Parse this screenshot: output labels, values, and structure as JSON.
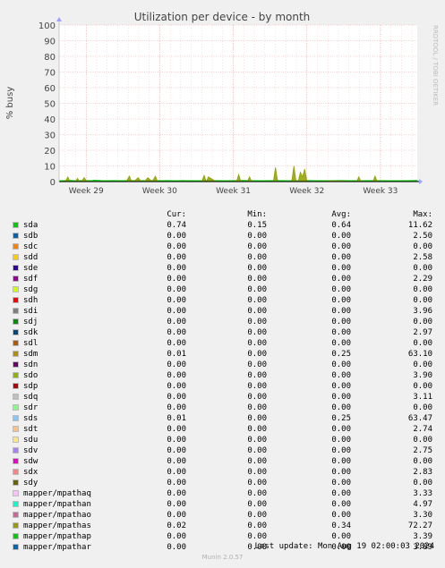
{
  "chart_data": {
    "type": "area",
    "title": "Utilization per device - by month",
    "ylabel": "% busy",
    "side_label": "RRDTOOL / TOBI OETIKER",
    "ylim": [
      0,
      100
    ],
    "yticks": [
      0,
      10,
      20,
      30,
      40,
      50,
      60,
      70,
      80,
      90,
      100
    ],
    "xlim": [
      0,
      33.1
    ],
    "xticks": [
      {
        "label": "Week 29",
        "x": 2.5
      },
      {
        "label": "Week 30",
        "x": 9.3
      },
      {
        "label": "Week 31",
        "x": 16.1
      },
      {
        "label": "Week 32",
        "x": 22.9
      },
      {
        "label": "Week 33",
        "x": 29.7
      }
    ],
    "grid": true,
    "series": [
      {
        "name": "sda",
        "color": "#00cc00",
        "x": [
          0,
          0.5,
          0.8,
          1.4,
          2.0,
          3.0,
          3.3,
          4.0,
          4.5,
          5.0,
          5.5,
          6.0,
          6.5,
          7.0,
          7.5,
          8.0,
          8.5,
          9.0,
          9.5,
          10.0,
          10.5,
          11.0,
          11.5,
          12.0,
          13.0,
          14.0,
          15.0,
          16.0,
          17.0,
          18.0,
          19.0,
          20.0,
          21.0,
          22.0,
          23.0,
          24.0,
          25.0,
          26.0,
          27.0,
          28.0,
          29.0,
          30.0,
          31.0,
          32.0,
          33.1
        ],
        "y": [
          0.6,
          0.6,
          1.0,
          0.6,
          0.7,
          0.6,
          0.9,
          0.6,
          0.6,
          0.7,
          0.6,
          0.6,
          0.8,
          0.6,
          0.6,
          0.6,
          0.7,
          0.6,
          0.6,
          0.7,
          0.6,
          0.6,
          0.7,
          0.6,
          0.6,
          0.7,
          0.6,
          0.6,
          0.8,
          0.6,
          0.6,
          0.7,
          0.6,
          0.6,
          0.7,
          0.6,
          0.6,
          0.7,
          0.6,
          0.6,
          0.7,
          0.6,
          0.6,
          0.6,
          0.74
        ]
      },
      {
        "name": "mapper/mpathas",
        "color": "#8fa000",
        "x": [
          0,
          0.6,
          0.8,
          1.0,
          1.5,
          1.7,
          1.9,
          2.1,
          2.3,
          2.6,
          4.5,
          6.2,
          6.5,
          6.7,
          6.9,
          7.3,
          7.6,
          7.9,
          8.2,
          8.6,
          8.9,
          9.1,
          9.3,
          13.2,
          13.4,
          13.6,
          13.8,
          14.5,
          16.4,
          16.6,
          16.8,
          17.0,
          17.4,
          17.6,
          17.8,
          19.8,
          20.0,
          20.2,
          21.5,
          21.7,
          21.9,
          22.1,
          22.3,
          22.5,
          22.7,
          22.9,
          23.1,
          24.5,
          25.2,
          27.5,
          27.7,
          27.9,
          28.3,
          29.0,
          29.2,
          29.4,
          29.8,
          33.1
        ],
        "y": [
          0,
          0,
          3,
          0,
          0,
          2,
          0,
          0,
          2.5,
          0,
          0,
          0,
          3.5,
          0,
          0,
          2.5,
          0,
          0,
          2.5,
          0,
          3.5,
          0,
          0,
          0,
          4,
          0,
          3,
          0,
          0,
          4.5,
          0,
          0,
          0,
          3,
          0,
          0,
          9,
          0,
          0,
          10,
          0,
          0,
          6,
          3,
          8,
          0,
          0,
          0,
          0.5,
          0,
          3,
          0,
          0,
          0,
          3.5,
          0,
          0,
          0
        ]
      }
    ],
    "legend": {
      "headers": [
        "Cur:",
        "Min:",
        "Avg:",
        "Max:"
      ],
      "rows": [
        {
          "name": "sda",
          "color": "#00cc00",
          "cur": "0.74",
          "min": "0.15",
          "avg": "0.64",
          "max": "11.62"
        },
        {
          "name": "sdb",
          "color": "#0066b3",
          "cur": "0.00",
          "min": "0.00",
          "avg": "0.00",
          "max": "2.50"
        },
        {
          "name": "sdc",
          "color": "#ff8000",
          "cur": "0.00",
          "min": "0.00",
          "avg": "0.00",
          "max": "0.00"
        },
        {
          "name": "sdd",
          "color": "#ffcc00",
          "cur": "0.00",
          "min": "0.00",
          "avg": "0.00",
          "max": "2.58"
        },
        {
          "name": "sde",
          "color": "#330099",
          "cur": "0.00",
          "min": "0.00",
          "avg": "0.00",
          "max": "0.00"
        },
        {
          "name": "sdf",
          "color": "#990099",
          "cur": "0.00",
          "min": "0.00",
          "avg": "0.00",
          "max": "2.29"
        },
        {
          "name": "sdg",
          "color": "#ccff00",
          "cur": "0.00",
          "min": "0.00",
          "avg": "0.00",
          "max": "0.00"
        },
        {
          "name": "sdh",
          "color": "#ff0000",
          "cur": "0.00",
          "min": "0.00",
          "avg": "0.00",
          "max": "0.00"
        },
        {
          "name": "sdi",
          "color": "#808080",
          "cur": "0.00",
          "min": "0.00",
          "avg": "0.00",
          "max": "3.96"
        },
        {
          "name": "sdj",
          "color": "#008f00",
          "cur": "0.00",
          "min": "0.00",
          "avg": "0.00",
          "max": "0.00"
        },
        {
          "name": "sdk",
          "color": "#00487d",
          "cur": "0.00",
          "min": "0.00",
          "avg": "0.00",
          "max": "2.97"
        },
        {
          "name": "sdl",
          "color": "#b35a00",
          "cur": "0.00",
          "min": "0.00",
          "avg": "0.00",
          "max": "0.00"
        },
        {
          "name": "sdm",
          "color": "#b38f00",
          "cur": "0.01",
          "min": "0.00",
          "avg": "0.25",
          "max": "63.10"
        },
        {
          "name": "sdn",
          "color": "#6b006b",
          "cur": "0.00",
          "min": "0.00",
          "avg": "0.00",
          "max": "0.00"
        },
        {
          "name": "sdo",
          "color": "#8fb300",
          "cur": "0.00",
          "min": "0.00",
          "avg": "0.00",
          "max": "3.90"
        },
        {
          "name": "sdp",
          "color": "#b30000",
          "cur": "0.00",
          "min": "0.00",
          "avg": "0.00",
          "max": "0.00"
        },
        {
          "name": "sdq",
          "color": "#bebebe",
          "cur": "0.00",
          "min": "0.00",
          "avg": "0.00",
          "max": "3.11"
        },
        {
          "name": "sdr",
          "color": "#80ff80",
          "cur": "0.00",
          "min": "0.00",
          "avg": "0.00",
          "max": "0.00"
        },
        {
          "name": "sds",
          "color": "#80c9ff",
          "cur": "0.01",
          "min": "0.00",
          "avg": "0.25",
          "max": "63.47"
        },
        {
          "name": "sdt",
          "color": "#ffc080",
          "cur": "0.00",
          "min": "0.00",
          "avg": "0.00",
          "max": "2.74"
        },
        {
          "name": "sdu",
          "color": "#ffe680",
          "cur": "0.00",
          "min": "0.00",
          "avg": "0.00",
          "max": "0.00"
        },
        {
          "name": "sdv",
          "color": "#aa80ff",
          "cur": "0.00",
          "min": "0.00",
          "avg": "0.00",
          "max": "2.75"
        },
        {
          "name": "sdw",
          "color": "#ee00cc",
          "cur": "0.00",
          "min": "0.00",
          "avg": "0.00",
          "max": "0.00"
        },
        {
          "name": "sdx",
          "color": "#ff8080",
          "cur": "0.00",
          "min": "0.00",
          "avg": "0.00",
          "max": "2.83"
        },
        {
          "name": "sdy",
          "color": "#666600",
          "cur": "0.00",
          "min": "0.00",
          "avg": "0.00",
          "max": "0.00"
        },
        {
          "name": "mapper/mpathaq",
          "color": "#ffbfff",
          "cur": "0.00",
          "min": "0.00",
          "avg": "0.00",
          "max": "3.33"
        },
        {
          "name": "mapper/mpathan",
          "color": "#00ffcc",
          "cur": "0.00",
          "min": "0.00",
          "avg": "0.00",
          "max": "4.97"
        },
        {
          "name": "mapper/mpathao",
          "color": "#cc6699",
          "cur": "0.00",
          "min": "0.00",
          "avg": "0.00",
          "max": "3.30"
        },
        {
          "name": "mapper/mpathas",
          "color": "#999900",
          "cur": "0.02",
          "min": "0.00",
          "avg": "0.34",
          "max": "72.27"
        },
        {
          "name": "mapper/mpathap",
          "color": "#00cc00",
          "cur": "0.00",
          "min": "0.00",
          "avg": "0.00",
          "max": "3.39"
        },
        {
          "name": "mapper/mpathar",
          "color": "#0066b3",
          "cur": "0.00",
          "min": "0.00",
          "avg": "0.00",
          "max": "3.89"
        }
      ]
    },
    "last_update": "Last update: Mon Aug 19 02:00:03 2024",
    "footer": "Munin 2.0.57"
  }
}
